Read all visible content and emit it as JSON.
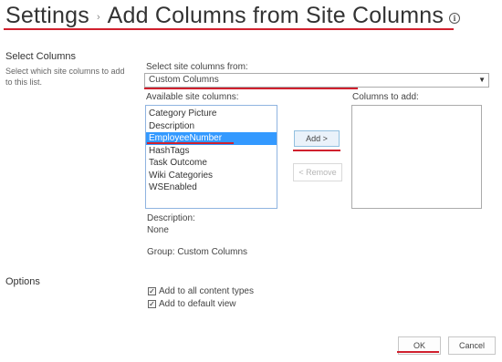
{
  "header": {
    "settings_label": "Settings",
    "separator": "›",
    "page_title": "Add Columns from Site Columns",
    "info_icon": "i"
  },
  "select_columns": {
    "title": "Select Columns",
    "description": "Select which site columns to add to this list.",
    "source_label": "Select site columns from:",
    "source_value": "Custom Columns",
    "available_label": "Available site columns:",
    "available_items": [
      "Category Picture",
      "Description",
      "EmployeeNumber",
      "HashTags",
      "Task Outcome",
      "Wiki Categories",
      "WSEnabled"
    ],
    "selected_item": "EmployeeNumber",
    "add_button": "Add >",
    "remove_button": "< Remove",
    "to_add_label": "Columns to add:",
    "description_label": "Description:",
    "description_value": "None",
    "group_text": "Group: Custom Columns"
  },
  "options": {
    "title": "Options",
    "add_all_content_types": "Add to all content types",
    "add_default_view": "Add to default view",
    "add_all_checked": true,
    "add_default_checked": true
  },
  "footer": {
    "ok": "OK",
    "cancel": "Cancel"
  },
  "colors": {
    "highlight": "#3399ff",
    "annotation_red": "#d0202e"
  }
}
